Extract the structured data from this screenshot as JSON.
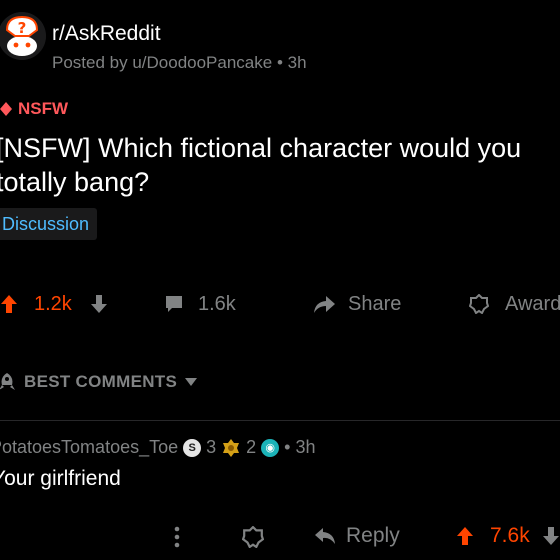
{
  "post": {
    "subreddit": "r/AskReddit",
    "posted_by": "Posted by u/DoodooPancake",
    "age": "3h",
    "nsfw_tag": "NSFW",
    "title": "[NSFW] Which fictional character would you totally bang?",
    "flair": "Discussion",
    "upvotes": "1.2k",
    "comments": "1.6k",
    "share_label": "Share",
    "award_label": "Award"
  },
  "comments_section": {
    "sort_label": "BEST COMMENTS"
  },
  "comment": {
    "author": "PotatoesTomatoes_Toe",
    "award_silver_count": "3",
    "award_gold_count": "2",
    "age": "3h",
    "body": "Your girlfriend",
    "reply_label": "Reply",
    "score": "7.6k"
  },
  "colors": {
    "background": "#000000",
    "upvote": "#ff4500",
    "nsfw": "#ff585b",
    "flair_text": "#4fbcff",
    "muted": "#818384"
  }
}
